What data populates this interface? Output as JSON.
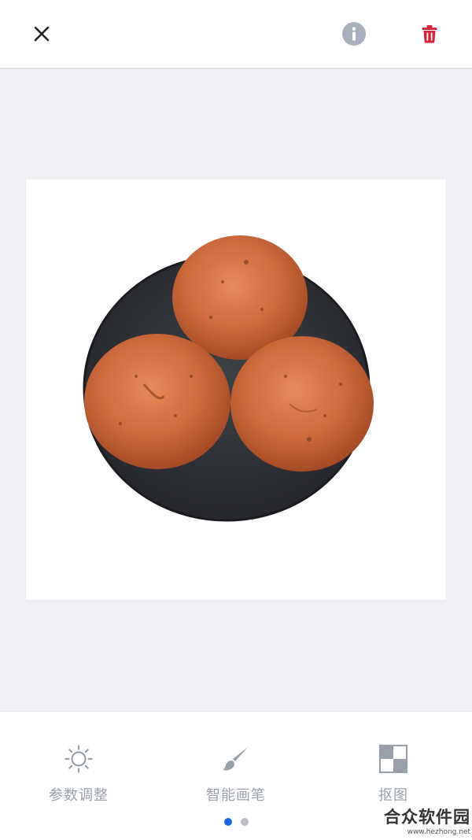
{
  "header": {
    "close_icon": "close-icon",
    "info_icon": "info-icon",
    "delete_icon": "trash-icon",
    "colors": {
      "info": "#a8b0bd",
      "delete": "#d3233a"
    }
  },
  "canvas": {
    "image_description_icon": "photo-bread-rolls"
  },
  "toolbar": {
    "tools": [
      {
        "label": "参数调整",
        "icon": "sun-icon"
      },
      {
        "label": "智能画笔",
        "icon": "brush-icon"
      },
      {
        "label": "抠图",
        "icon": "cutout-icon"
      }
    ],
    "pager": {
      "count": 2,
      "active": 0,
      "active_color": "#1b66e0"
    }
  },
  "watermark": {
    "main": "合众软件园",
    "sub": "www.hezhong.net"
  }
}
